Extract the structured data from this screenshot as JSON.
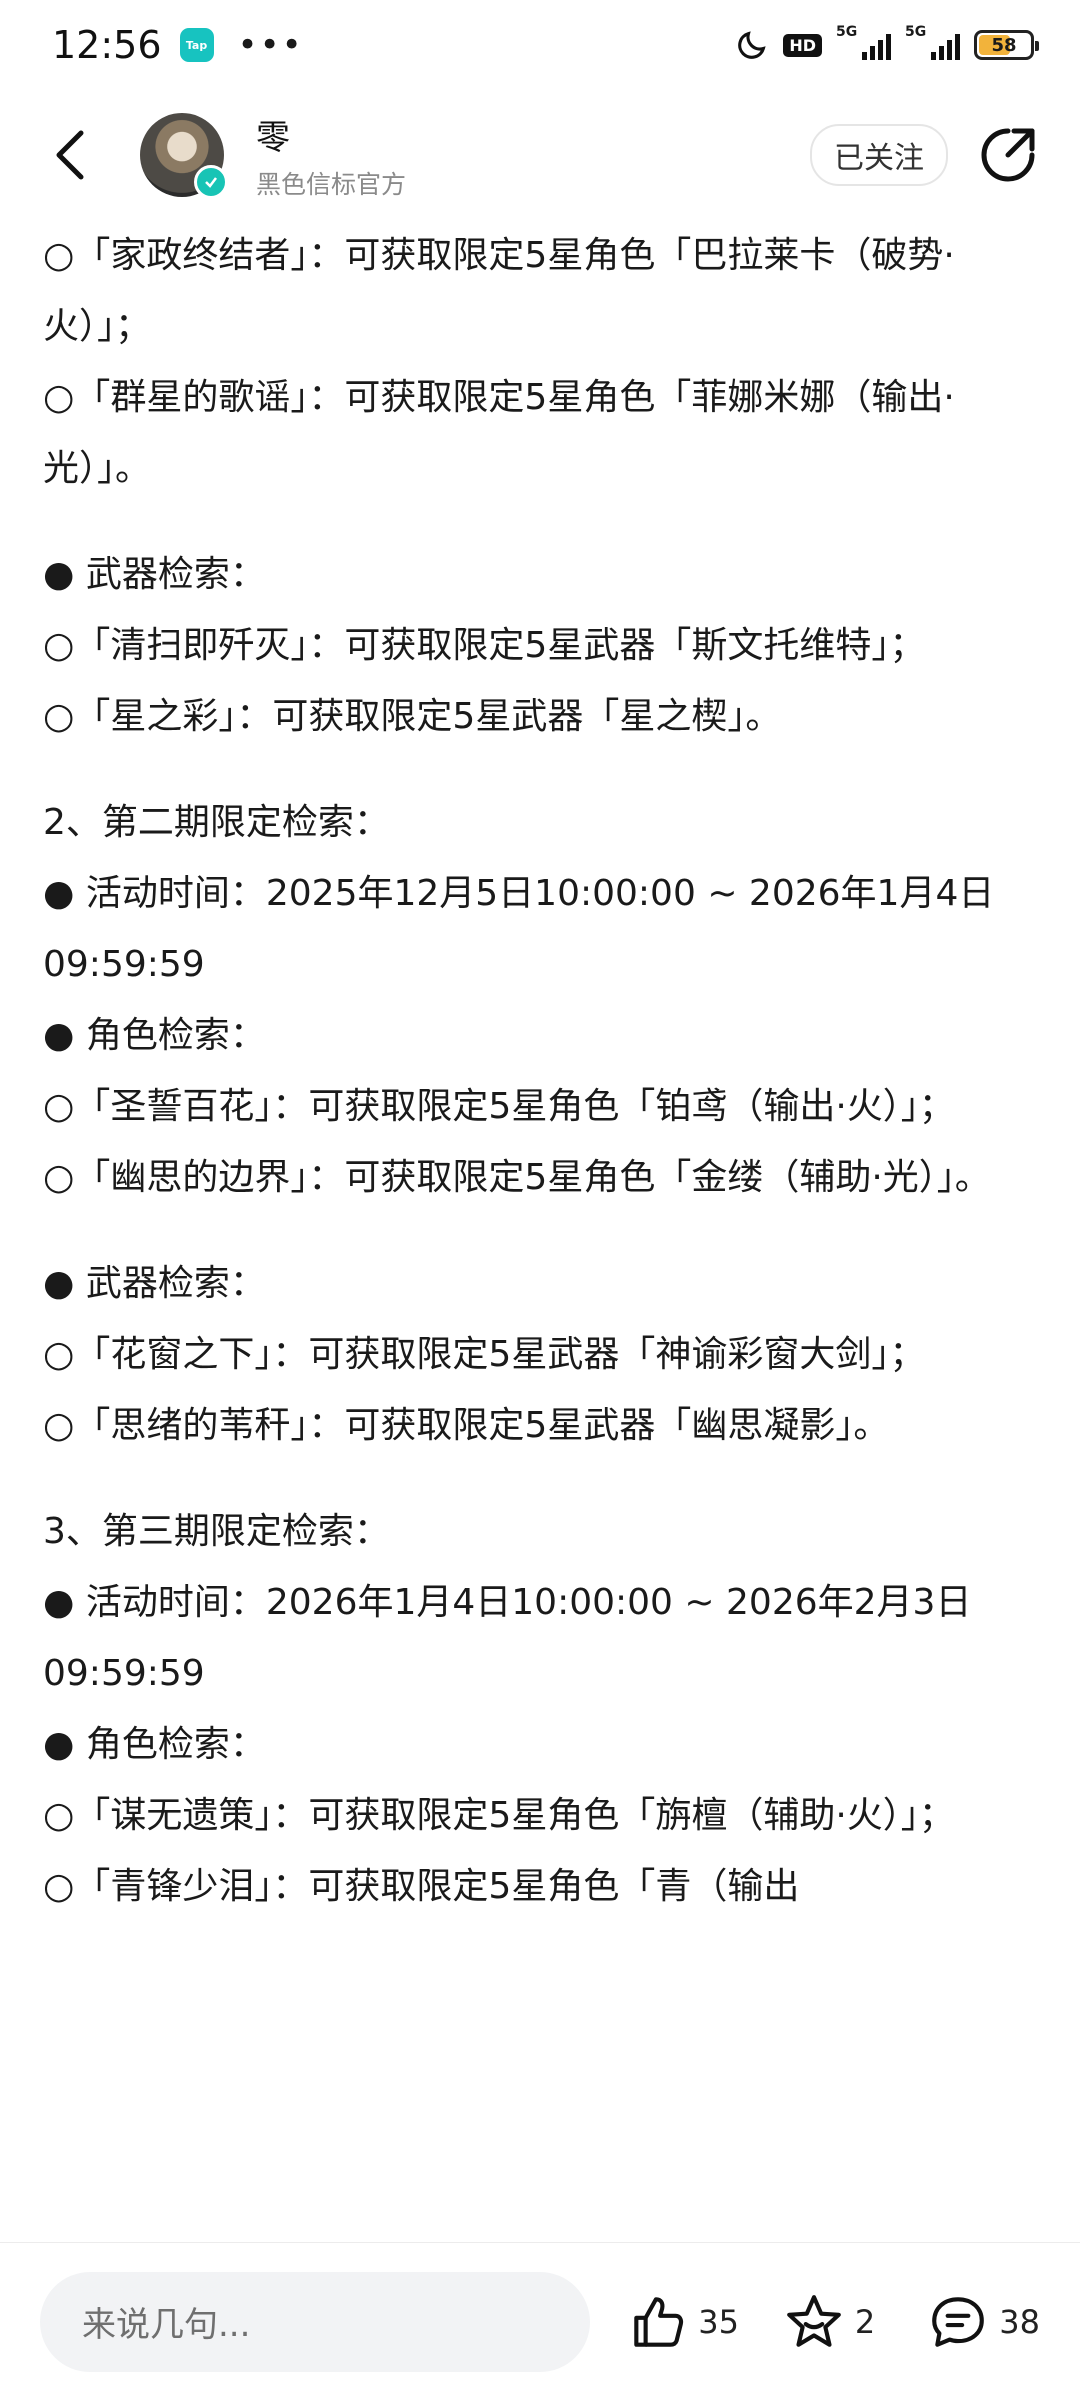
{
  "status": {
    "time": "12:56",
    "tap_badge": "Tap",
    "hd": "HD",
    "net1": "5G",
    "net2": "5G",
    "battery": "58"
  },
  "header": {
    "author_name": "零",
    "author_subtitle": "黑色信标官方",
    "follow_label": "已关注"
  },
  "paragraphs": [
    "○「家政终结者」：可获取限定5星角色「巴拉莱卡（破势·火）」；",
    "○「群星的歌谣」：可获取限定5星角色「菲娜米娜（输出·光）」。",
    "",
    "● 武器检索：",
    "○「清扫即歼灭」：可获取限定5星武器「斯文托维特」；",
    "○「星之彩」：可获取限定5星武器「星之楔」。",
    "",
    "2、第二期限定检索：",
    "● 活动时间：2025年12月5日10:00:00 ~ 2026年1月4日09:59:59",
    "● 角色检索：",
    "○「圣誓百花」：可获取限定5星角色「铂鸢（输出·火）」；",
    "○「幽思的边界」：可获取限定5星角色「金缕（辅助·光）」。",
    "",
    "● 武器检索：",
    "○「花窗之下」：可获取限定5星武器「神谕彩窗大剑」；",
    "○「思绪的苇秆」：可获取限定5星武器「幽思凝影」。",
    "",
    "3、第三期限定检索：",
    "● 活动时间：2026年1月4日10:00:00 ~ 2026年2月3日09:59:59",
    "● 角色检索：",
    "○「谋无遗策」：可获取限定5星角色「旃檀（辅助·火）」；",
    "○「青锋少泪」：可获取限定5星角色「青（输出"
  ],
  "bottom": {
    "comment_placeholder": "来说几句...",
    "likes": "35",
    "favorites": "2",
    "comments": "38"
  }
}
